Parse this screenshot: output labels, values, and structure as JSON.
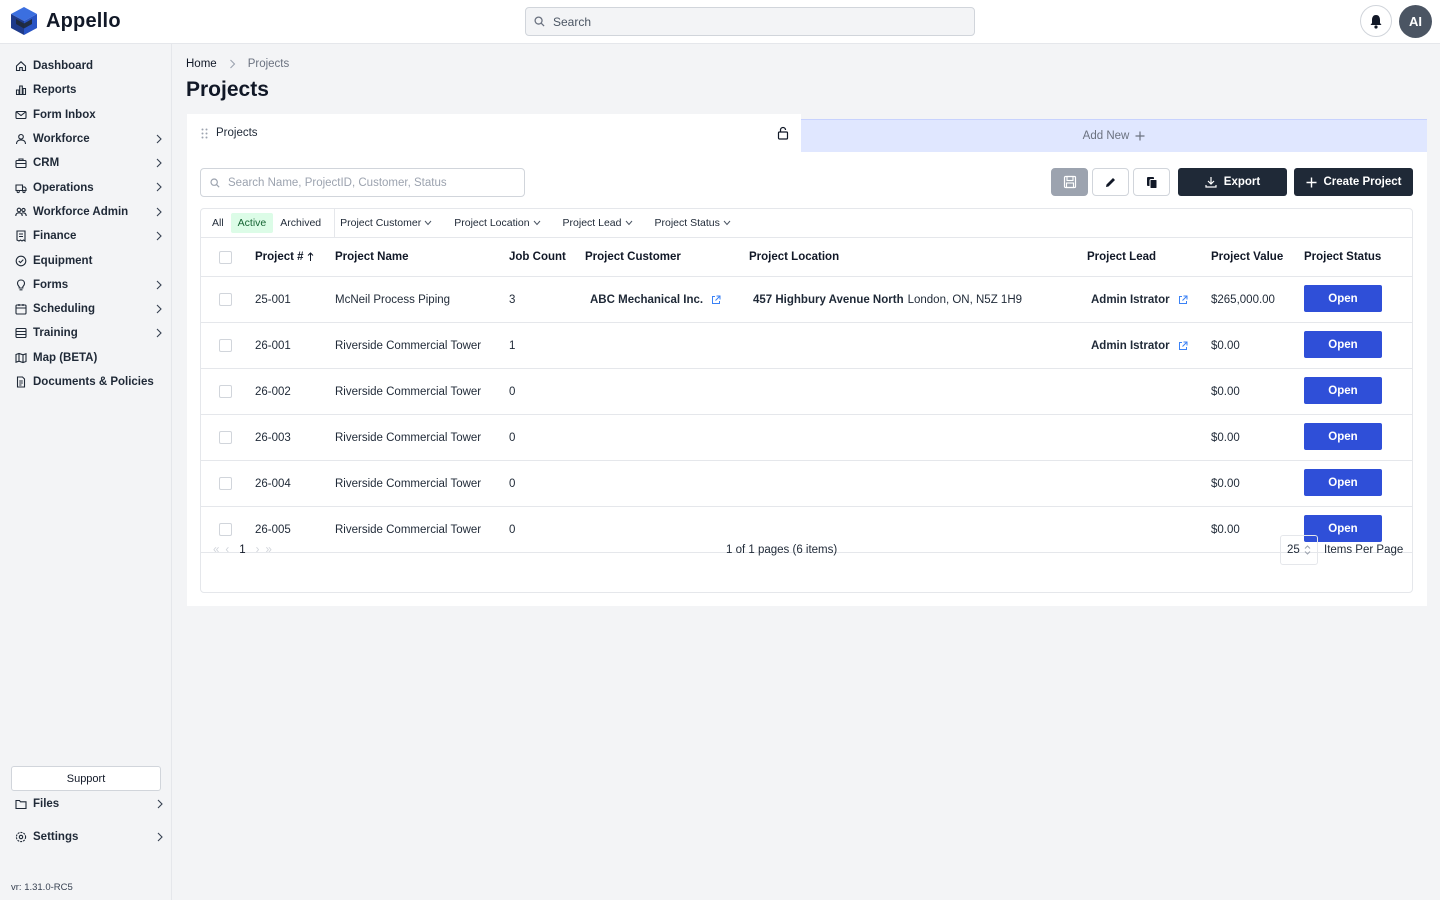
{
  "app": {
    "name": "Appello",
    "version": "vr: 1.31.0-RC5"
  },
  "top": {
    "search_placeholder": "Search",
    "avatar_initials": "AI"
  },
  "sidebar": {
    "items": [
      {
        "label": "Dashboard",
        "icon": "home-icon",
        "chevron": false
      },
      {
        "label": "Reports",
        "icon": "bar-chart-icon",
        "chevron": false
      },
      {
        "label": "Form Inbox",
        "icon": "mail-icon",
        "chevron": false
      },
      {
        "label": "Workforce",
        "icon": "user-icon",
        "chevron": true
      },
      {
        "label": "CRM",
        "icon": "briefcase-icon",
        "chevron": true
      },
      {
        "label": "Operations",
        "icon": "truck-icon",
        "chevron": true
      },
      {
        "label": "Workforce Admin",
        "icon": "users-icon",
        "chevron": true
      },
      {
        "label": "Finance",
        "icon": "receipt-icon",
        "chevron": true
      },
      {
        "label": "Equipment",
        "icon": "check-circle-icon",
        "chevron": false
      },
      {
        "label": "Forms",
        "icon": "lightbulb-icon",
        "chevron": true
      },
      {
        "label": "Scheduling",
        "icon": "calendar-icon",
        "chevron": true
      },
      {
        "label": "Training",
        "icon": "book-icon",
        "chevron": true
      },
      {
        "label": "Map (BETA)",
        "icon": "map-icon",
        "chevron": false
      },
      {
        "label": "Documents & Policies",
        "icon": "document-icon",
        "chevron": false
      }
    ],
    "support_label": "Support",
    "files_label": "Files",
    "settings_label": "Settings"
  },
  "breadcrumb": {
    "home": "Home",
    "current": "Projects"
  },
  "page_title": "Projects",
  "tabs": {
    "active": "Projects",
    "add_new": "Add New"
  },
  "toolbar": {
    "search_placeholder": "Search Name, ProjectID, Customer, Status",
    "export_label": "Export",
    "create_label": "Create Project"
  },
  "filters": {
    "segments": [
      "All",
      "Active",
      "Archived"
    ],
    "active_segment": "Active",
    "dropdowns": [
      "Project Customer",
      "Project Location",
      "Project Lead",
      "Project Status"
    ]
  },
  "table": {
    "columns": [
      "Project #",
      "Project Name",
      "Job Count",
      "Project Customer",
      "Project Location",
      "Project Lead",
      "Project Value",
      "Project Status"
    ],
    "rows": [
      {
        "num": "25-001",
        "name": "McNeil Process Piping",
        "jobs": "3",
        "customer": "ABC Mechanical Inc.",
        "loc_street": "457 Highbury Avenue North",
        "loc_city": "London, ON, N5Z 1H9",
        "lead": "Admin Istrator",
        "value": "$265,000.00",
        "status": "Open"
      },
      {
        "num": "26-001",
        "name": "Riverside Commercial Tower",
        "jobs": "1",
        "customer": "",
        "loc_street": "",
        "loc_city": "",
        "lead": "Admin Istrator",
        "value": "$0.00",
        "status": "Open"
      },
      {
        "num": "26-002",
        "name": "Riverside Commercial Tower",
        "jobs": "0",
        "customer": "",
        "loc_street": "",
        "loc_city": "",
        "lead": "",
        "value": "$0.00",
        "status": "Open"
      },
      {
        "num": "26-003",
        "name": "Riverside Commercial Tower",
        "jobs": "0",
        "customer": "",
        "loc_street": "",
        "loc_city": "",
        "lead": "",
        "value": "$0.00",
        "status": "Open"
      },
      {
        "num": "26-004",
        "name": "Riverside Commercial Tower",
        "jobs": "0",
        "customer": "",
        "loc_street": "",
        "loc_city": "",
        "lead": "",
        "value": "$0.00",
        "status": "Open"
      },
      {
        "num": "26-005",
        "name": "Riverside Commercial Tower",
        "jobs": "0",
        "customer": "",
        "loc_street": "",
        "loc_city": "",
        "lead": "",
        "value": "$0.00",
        "status": "Open"
      }
    ]
  },
  "pager": {
    "page": "1",
    "summary": "1 of 1 pages (6 items)",
    "items_per_page": "25",
    "items_per_page_label": "Items Per Page"
  },
  "colors": {
    "primary_button": "#2f4fd8",
    "dark_button": "#1f2937",
    "active_filter": "#dcfce7",
    "add_tab": "#e0e7ff"
  }
}
